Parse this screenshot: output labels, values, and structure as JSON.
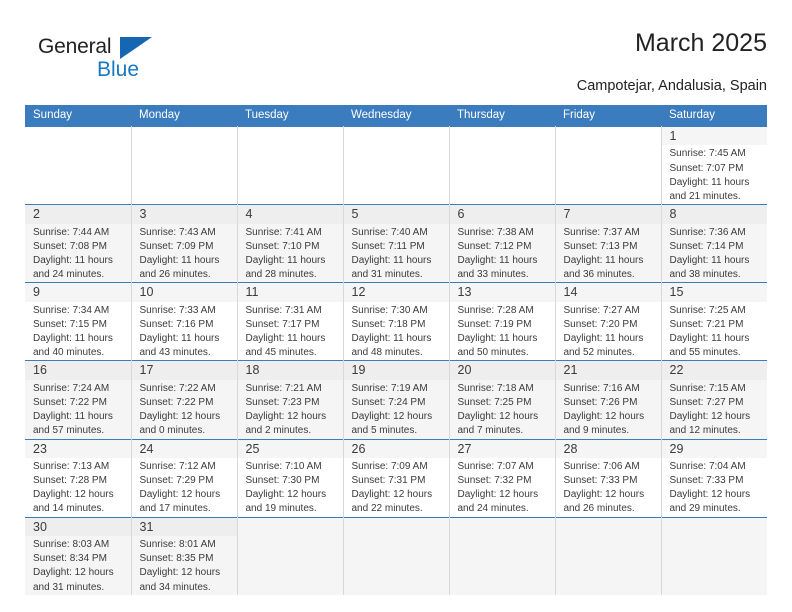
{
  "brand": {
    "name_top": "General",
    "name_bottom": "Blue",
    "triangle_color": "#1567b4",
    "blue_color": "#1779c4"
  },
  "header": {
    "title": "March 2025",
    "subtitle": "Campotejar, Andalusia, Spain"
  },
  "theme": {
    "header_row_bg": "#3a7cbe",
    "header_row_text": "#ffffff",
    "alt_row_bg": "#f5f5f5",
    "grid_line": "#d8d8d8",
    "text": "#3b3b3b"
  },
  "calendar": {
    "weekday_headers": [
      "Sunday",
      "Monday",
      "Tuesday",
      "Wednesday",
      "Thursday",
      "Friday",
      "Saturday"
    ],
    "weeks": [
      [
        {
          "day": "",
          "sunrise": "",
          "sunset": "",
          "daylight_line1": "",
          "daylight_line2": ""
        },
        {
          "day": "",
          "sunrise": "",
          "sunset": "",
          "daylight_line1": "",
          "daylight_line2": ""
        },
        {
          "day": "",
          "sunrise": "",
          "sunset": "",
          "daylight_line1": "",
          "daylight_line2": ""
        },
        {
          "day": "",
          "sunrise": "",
          "sunset": "",
          "daylight_line1": "",
          "daylight_line2": ""
        },
        {
          "day": "",
          "sunrise": "",
          "sunset": "",
          "daylight_line1": "",
          "daylight_line2": ""
        },
        {
          "day": "",
          "sunrise": "",
          "sunset": "",
          "daylight_line1": "",
          "daylight_line2": ""
        },
        {
          "day": "1",
          "sunrise": "Sunrise: 7:45 AM",
          "sunset": "Sunset: 7:07 PM",
          "daylight_line1": "Daylight: 11 hours",
          "daylight_line2": "and 21 minutes."
        }
      ],
      [
        {
          "day": "2",
          "sunrise": "Sunrise: 7:44 AM",
          "sunset": "Sunset: 7:08 PM",
          "daylight_line1": "Daylight: 11 hours",
          "daylight_line2": "and 24 minutes."
        },
        {
          "day": "3",
          "sunrise": "Sunrise: 7:43 AM",
          "sunset": "Sunset: 7:09 PM",
          "daylight_line1": "Daylight: 11 hours",
          "daylight_line2": "and 26 minutes."
        },
        {
          "day": "4",
          "sunrise": "Sunrise: 7:41 AM",
          "sunset": "Sunset: 7:10 PM",
          "daylight_line1": "Daylight: 11 hours",
          "daylight_line2": "and 28 minutes."
        },
        {
          "day": "5",
          "sunrise": "Sunrise: 7:40 AM",
          "sunset": "Sunset: 7:11 PM",
          "daylight_line1": "Daylight: 11 hours",
          "daylight_line2": "and 31 minutes."
        },
        {
          "day": "6",
          "sunrise": "Sunrise: 7:38 AM",
          "sunset": "Sunset: 7:12 PM",
          "daylight_line1": "Daylight: 11 hours",
          "daylight_line2": "and 33 minutes."
        },
        {
          "day": "7",
          "sunrise": "Sunrise: 7:37 AM",
          "sunset": "Sunset: 7:13 PM",
          "daylight_line1": "Daylight: 11 hours",
          "daylight_line2": "and 36 minutes."
        },
        {
          "day": "8",
          "sunrise": "Sunrise: 7:36 AM",
          "sunset": "Sunset: 7:14 PM",
          "daylight_line1": "Daylight: 11 hours",
          "daylight_line2": "and 38 minutes."
        }
      ],
      [
        {
          "day": "9",
          "sunrise": "Sunrise: 7:34 AM",
          "sunset": "Sunset: 7:15 PM",
          "daylight_line1": "Daylight: 11 hours",
          "daylight_line2": "and 40 minutes."
        },
        {
          "day": "10",
          "sunrise": "Sunrise: 7:33 AM",
          "sunset": "Sunset: 7:16 PM",
          "daylight_line1": "Daylight: 11 hours",
          "daylight_line2": "and 43 minutes."
        },
        {
          "day": "11",
          "sunrise": "Sunrise: 7:31 AM",
          "sunset": "Sunset: 7:17 PM",
          "daylight_line1": "Daylight: 11 hours",
          "daylight_line2": "and 45 minutes."
        },
        {
          "day": "12",
          "sunrise": "Sunrise: 7:30 AM",
          "sunset": "Sunset: 7:18 PM",
          "daylight_line1": "Daylight: 11 hours",
          "daylight_line2": "and 48 minutes."
        },
        {
          "day": "13",
          "sunrise": "Sunrise: 7:28 AM",
          "sunset": "Sunset: 7:19 PM",
          "daylight_line1": "Daylight: 11 hours",
          "daylight_line2": "and 50 minutes."
        },
        {
          "day": "14",
          "sunrise": "Sunrise: 7:27 AM",
          "sunset": "Sunset: 7:20 PM",
          "daylight_line1": "Daylight: 11 hours",
          "daylight_line2": "and 52 minutes."
        },
        {
          "day": "15",
          "sunrise": "Sunrise: 7:25 AM",
          "sunset": "Sunset: 7:21 PM",
          "daylight_line1": "Daylight: 11 hours",
          "daylight_line2": "and 55 minutes."
        }
      ],
      [
        {
          "day": "16",
          "sunrise": "Sunrise: 7:24 AM",
          "sunset": "Sunset: 7:22 PM",
          "daylight_line1": "Daylight: 11 hours",
          "daylight_line2": "and 57 minutes."
        },
        {
          "day": "17",
          "sunrise": "Sunrise: 7:22 AM",
          "sunset": "Sunset: 7:22 PM",
          "daylight_line1": "Daylight: 12 hours",
          "daylight_line2": "and 0 minutes."
        },
        {
          "day": "18",
          "sunrise": "Sunrise: 7:21 AM",
          "sunset": "Sunset: 7:23 PM",
          "daylight_line1": "Daylight: 12 hours",
          "daylight_line2": "and 2 minutes."
        },
        {
          "day": "19",
          "sunrise": "Sunrise: 7:19 AM",
          "sunset": "Sunset: 7:24 PM",
          "daylight_line1": "Daylight: 12 hours",
          "daylight_line2": "and 5 minutes."
        },
        {
          "day": "20",
          "sunrise": "Sunrise: 7:18 AM",
          "sunset": "Sunset: 7:25 PM",
          "daylight_line1": "Daylight: 12 hours",
          "daylight_line2": "and 7 minutes."
        },
        {
          "day": "21",
          "sunrise": "Sunrise: 7:16 AM",
          "sunset": "Sunset: 7:26 PM",
          "daylight_line1": "Daylight: 12 hours",
          "daylight_line2": "and 9 minutes."
        },
        {
          "day": "22",
          "sunrise": "Sunrise: 7:15 AM",
          "sunset": "Sunset: 7:27 PM",
          "daylight_line1": "Daylight: 12 hours",
          "daylight_line2": "and 12 minutes."
        }
      ],
      [
        {
          "day": "23",
          "sunrise": "Sunrise: 7:13 AM",
          "sunset": "Sunset: 7:28 PM",
          "daylight_line1": "Daylight: 12 hours",
          "daylight_line2": "and 14 minutes."
        },
        {
          "day": "24",
          "sunrise": "Sunrise: 7:12 AM",
          "sunset": "Sunset: 7:29 PM",
          "daylight_line1": "Daylight: 12 hours",
          "daylight_line2": "and 17 minutes."
        },
        {
          "day": "25",
          "sunrise": "Sunrise: 7:10 AM",
          "sunset": "Sunset: 7:30 PM",
          "daylight_line1": "Daylight: 12 hours",
          "daylight_line2": "and 19 minutes."
        },
        {
          "day": "26",
          "sunrise": "Sunrise: 7:09 AM",
          "sunset": "Sunset: 7:31 PM",
          "daylight_line1": "Daylight: 12 hours",
          "daylight_line2": "and 22 minutes."
        },
        {
          "day": "27",
          "sunrise": "Sunrise: 7:07 AM",
          "sunset": "Sunset: 7:32 PM",
          "daylight_line1": "Daylight: 12 hours",
          "daylight_line2": "and 24 minutes."
        },
        {
          "day": "28",
          "sunrise": "Sunrise: 7:06 AM",
          "sunset": "Sunset: 7:33 PM",
          "daylight_line1": "Daylight: 12 hours",
          "daylight_line2": "and 26 minutes."
        },
        {
          "day": "29",
          "sunrise": "Sunrise: 7:04 AM",
          "sunset": "Sunset: 7:33 PM",
          "daylight_line1": "Daylight: 12 hours",
          "daylight_line2": "and 29 minutes."
        }
      ],
      [
        {
          "day": "30",
          "sunrise": "Sunrise: 8:03 AM",
          "sunset": "Sunset: 8:34 PM",
          "daylight_line1": "Daylight: 12 hours",
          "daylight_line2": "and 31 minutes."
        },
        {
          "day": "31",
          "sunrise": "Sunrise: 8:01 AM",
          "sunset": "Sunset: 8:35 PM",
          "daylight_line1": "Daylight: 12 hours",
          "daylight_line2": "and 34 minutes."
        },
        {
          "day": "",
          "sunrise": "",
          "sunset": "",
          "daylight_line1": "",
          "daylight_line2": ""
        },
        {
          "day": "",
          "sunrise": "",
          "sunset": "",
          "daylight_line1": "",
          "daylight_line2": ""
        },
        {
          "day": "",
          "sunrise": "",
          "sunset": "",
          "daylight_line1": "",
          "daylight_line2": ""
        },
        {
          "day": "",
          "sunrise": "",
          "sunset": "",
          "daylight_line1": "",
          "daylight_line2": ""
        },
        {
          "day": "",
          "sunrise": "",
          "sunset": "",
          "daylight_line1": "",
          "daylight_line2": ""
        }
      ]
    ]
  }
}
